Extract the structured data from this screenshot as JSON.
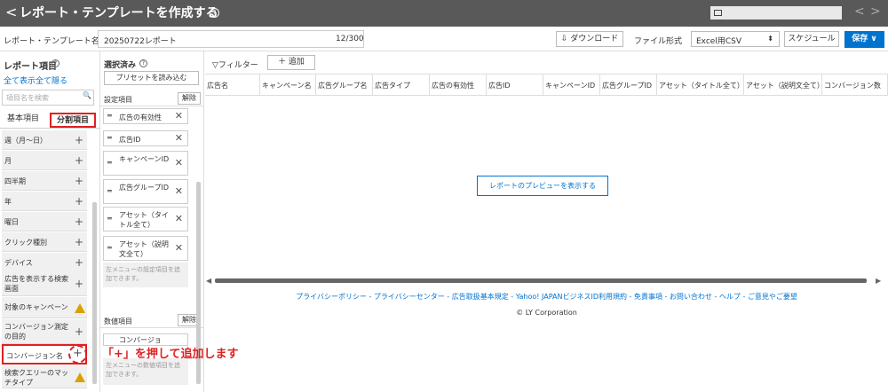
{
  "header": {
    "back": "<",
    "title": "レポート・テンプレートを作成する",
    "help": "?",
    "prev": "<",
    "next": ">"
  },
  "form": {
    "name_label": "レポート・テンプレート名",
    "name_value": "20250722レポート",
    "count": "12/300",
    "download": "⇩ ダウンロード",
    "format_label": "ファイル形式",
    "format_value": "Excel用CSV",
    "format_arrow": "⬍",
    "schedule": "スケジュール",
    "save": "保存 ∨"
  },
  "left": {
    "title": "レポート項目",
    "help": "?",
    "show_all": "全て表示",
    "collapse_all": "全て隠る",
    "search_placeholder": "項目名を検索",
    "search_icon": "🔍",
    "tab_basic": "基本項目",
    "tab_split": "分割項目",
    "items": [
      {
        "label": "週（月〜日）",
        "icon": "+"
      },
      {
        "label": "月",
        "icon": "+"
      },
      {
        "label": "四半期",
        "icon": "+"
      },
      {
        "label": "年",
        "icon": "+"
      },
      {
        "label": "曜日",
        "icon": "+"
      },
      {
        "label": "クリック種別",
        "icon": "+"
      },
      {
        "label": "デバイス",
        "icon": "+"
      },
      {
        "label": "広告を表示する検索画面",
        "icon": "+"
      },
      {
        "label": "対象のキャンペーン",
        "icon": "warn"
      },
      {
        "label": "コンバージョン測定の目的",
        "icon": "+"
      },
      {
        "label": "コンバージョン名",
        "icon": "+"
      },
      {
        "label": "検索クエリーのマッチタイプ",
        "icon": "warn"
      }
    ]
  },
  "middle": {
    "title": "選択済み",
    "help": "?",
    "preset": "プリセットを読み込む",
    "settings_label": "設定項目",
    "clear": "解除",
    "drag": "═",
    "cards": [
      {
        "label": "広告の有効性"
      },
      {
        "label": "広告ID"
      },
      {
        "label": "キャンペーンID"
      },
      {
        "label": "広告グループID"
      },
      {
        "label": "アセット（タイトル全て）"
      },
      {
        "label": "アセット（説明文全て）"
      }
    ],
    "remove": "✕",
    "settings_note": "左メニューの設定項目を追加できます。",
    "numeric_label": "数値項目",
    "numeric_clear": "解除",
    "numeric_card": "コンバージョ",
    "numeric_note": "左メニューの数値項目を追加できます。"
  },
  "preview": {
    "filter": "▽フィルター",
    "add": "＋ 追加",
    "columns": [
      "広告名",
      "キャンペーン名",
      "広告グループ名",
      "広告タイプ",
      "広告の有効性",
      "広告ID",
      "キャンペーンID",
      "広告グループID",
      "アセット（タイトル全て）",
      "アセット（説明文全て）",
      "コンバージョン数"
    ],
    "show_preview": "レポートのプレビューを表示する",
    "scroll_left": "◀",
    "scroll_right": "▶"
  },
  "footer": {
    "links": "プライバシーポリシー - プライバシーセンター - 広告取扱基本規定 - Yahoo! JAPANビジネスID利用規約 - 免責事項 - お問い合わせ - ヘルプ - ご意見やご要望",
    "copyright": "© LY Corporation"
  },
  "annotation": {
    "text": "「+」を押して追加します",
    "plus": "+"
  }
}
